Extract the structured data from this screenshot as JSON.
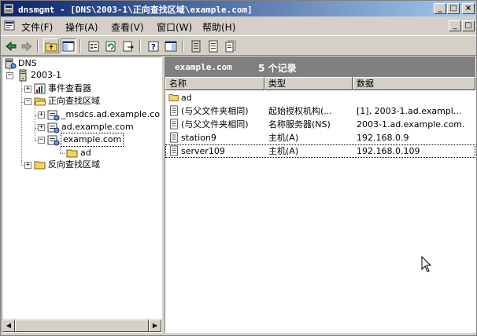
{
  "window": {
    "title": "dnsmgmt - [DNS\\2003-1\\正向查找区域\\example.com]",
    "min_label": "_",
    "max_label": "□",
    "close_label": "×",
    "inner_min_label": "_",
    "inner_max_label": "□"
  },
  "menu": {
    "items": [
      {
        "label": "文件(F)"
      },
      {
        "label": "操作(A)"
      },
      {
        "label": "查看(V)"
      },
      {
        "label": "窗口(W)"
      },
      {
        "label": "帮助(H)"
      }
    ]
  },
  "tree": {
    "root": "DNS",
    "server": "2003-1",
    "event_viewer": "事件查看器",
    "forward_zones": "正向查找区域",
    "msdcs_zone": "_msdcs.ad.example.co",
    "ad_zone": "ad.example.com",
    "example_zone": "example.com",
    "ad_folder": "ad",
    "reverse_zones": "反向查找区域"
  },
  "panel": {
    "zone_name": "example.com",
    "record_count": "5 个记录",
    "columns": [
      "名称",
      "类型",
      "数据"
    ],
    "records": [
      {
        "name": "ad",
        "type": "",
        "data": "",
        "icon": "folder-icon"
      },
      {
        "name": "(与父文件夹相同)",
        "type": "起始授权机构(...",
        "data": "[1], 2003-1.ad.exampl...",
        "icon": "record-icon"
      },
      {
        "name": "(与父文件夹相同)",
        "type": "名称服务器(NS)",
        "data": "2003-1.ad.example.com.",
        "icon": "record-icon"
      },
      {
        "name": "station9",
        "type": "主机(A)",
        "data": "192.168.0.9",
        "icon": "record-icon"
      },
      {
        "name": "server109",
        "type": "主机(A)",
        "data": "192.168.0.109",
        "icon": "record-icon"
      }
    ]
  }
}
